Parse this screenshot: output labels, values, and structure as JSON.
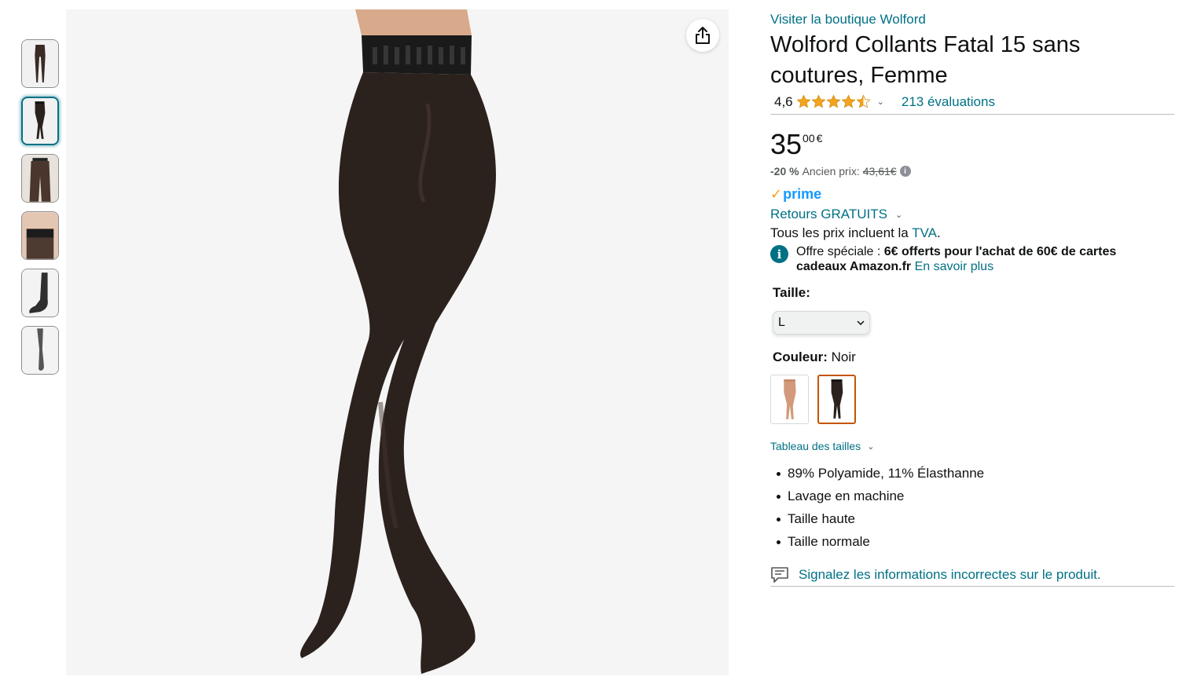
{
  "thumbnails": [
    {
      "name": "thumb-1"
    },
    {
      "name": "thumb-2",
      "selected": true
    },
    {
      "name": "thumb-3"
    },
    {
      "name": "thumb-4"
    },
    {
      "name": "thumb-5"
    },
    {
      "name": "thumb-6"
    }
  ],
  "share_icon": "share-icon",
  "product": {
    "store_link": "Visiter la boutique Wolford",
    "title": "Wolford Collants Fatal 15 sans coutures, Femme",
    "rating_value": "4,6",
    "stars": 4.5,
    "ratings_count": "213 évaluations",
    "price_whole": "35",
    "price_fraction": "00",
    "currency": "€",
    "discount": "-20 %",
    "old_price_label": "Ancien prix:",
    "old_price": "43,61€",
    "prime_label": "prime",
    "returns_label": "Retours GRATUITS",
    "tax_text": "Tous les prix incluent la ",
    "tax_link": "TVA",
    "tax_suffix": ".",
    "offer_prefix": "Offre spéciale : ",
    "offer_bold": "6€ offerts pour l'achat de 60€ de cartes cadeaux Amazon.fr",
    "offer_link": "En savoir plus",
    "size_label": "Taille:",
    "size_value": "L",
    "color_label": "Couleur:",
    "color_value": "Noir",
    "size_chart": "Tableau des tailles",
    "bullets": [
      "89% Polyamide, 11% Élasthanne",
      "Lavage en machine",
      "Taille haute",
      "Taille normale"
    ],
    "report_link": "Signalez les informations incorrectes sur le produit."
  },
  "colors": {
    "link": "#007185",
    "prime": "#1399ff",
    "star": "#f4a41c",
    "selected_swatch": "#c45500"
  }
}
